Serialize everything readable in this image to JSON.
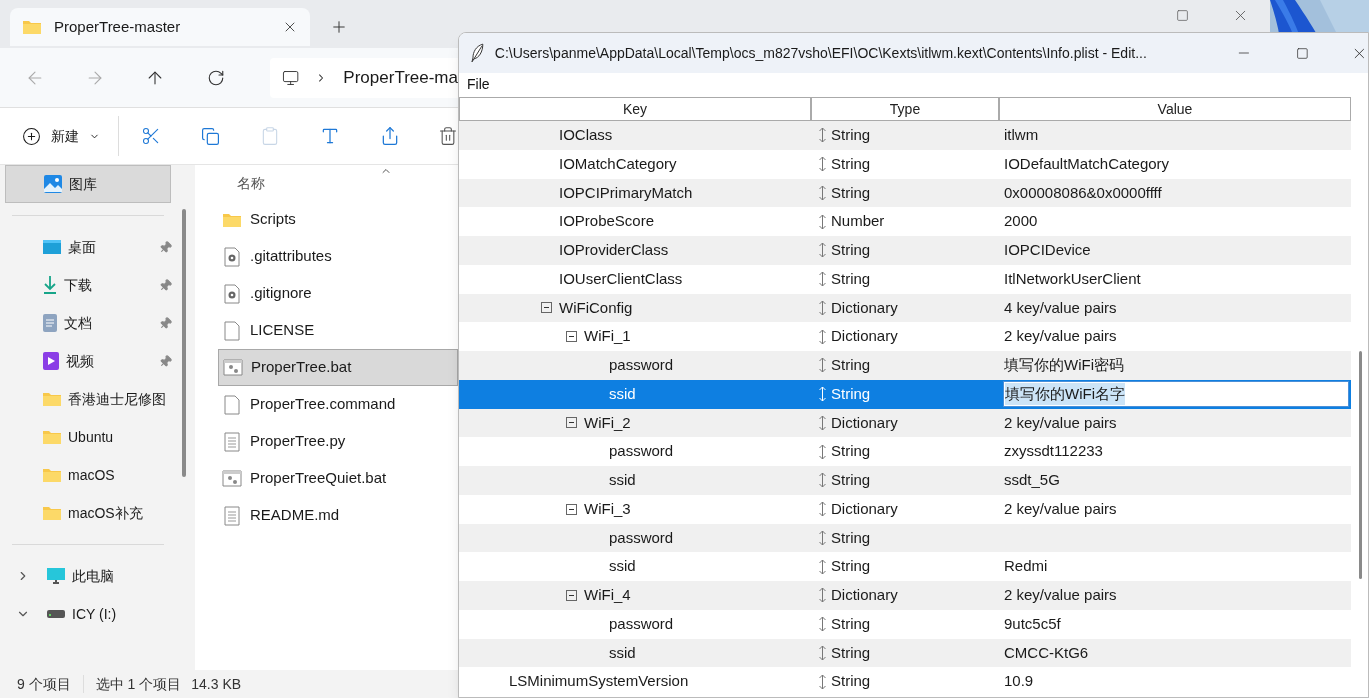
{
  "explorer": {
    "tab": {
      "title": "ProperTree-master"
    },
    "address": {
      "path": "ProperTree-ma"
    },
    "toolbar": {
      "new_label": "新建"
    },
    "sidebar": {
      "sections": [
        {
          "items": [
            {
              "label": "图库",
              "kind": "gallery",
              "selected": true
            }
          ]
        },
        {
          "items": [
            {
              "label": "桌面",
              "kind": "desktop",
              "pinned": true,
              "selected": false
            },
            {
              "label": "下载",
              "kind": "download",
              "pinned": true,
              "selected": false
            },
            {
              "label": "文档",
              "kind": "document",
              "pinned": true,
              "selected": false
            },
            {
              "label": "视频",
              "kind": "video",
              "pinned": true,
              "selected": false
            },
            {
              "label": "香港迪士尼修图",
              "kind": "folder",
              "pinned": false,
              "selected": false
            },
            {
              "label": "Ubuntu",
              "kind": "folder",
              "pinned": false,
              "selected": false
            },
            {
              "label": "macOS",
              "kind": "folder",
              "pinned": false,
              "selected": false
            },
            {
              "label": "macOS补充",
              "kind": "folder",
              "pinned": false,
              "selected": false
            }
          ]
        },
        {
          "items": [
            {
              "label": "此电脑",
              "kind": "computer",
              "expanded": false,
              "selected": false
            },
            {
              "label": "ICY (I:)",
              "kind": "drive",
              "expanded": true,
              "selected": false
            }
          ]
        }
      ]
    },
    "files": {
      "column": "名称",
      "rows": [
        {
          "name": "Scripts",
          "kind": "folder",
          "selected": false
        },
        {
          "name": ".gitattributes",
          "kind": "config",
          "selected": false
        },
        {
          "name": ".gitignore",
          "kind": "config",
          "selected": false
        },
        {
          "name": "LICENSE",
          "kind": "blank",
          "selected": false
        },
        {
          "name": "ProperTree.bat",
          "kind": "batch",
          "selected": true
        },
        {
          "name": "ProperTree.command",
          "kind": "blank",
          "selected": false
        },
        {
          "name": "ProperTree.py",
          "kind": "text",
          "selected": false
        },
        {
          "name": "ProperTreeQuiet.bat",
          "kind": "batch",
          "selected": false
        },
        {
          "name": "README.md",
          "kind": "text",
          "selected": false
        }
      ]
    },
    "status_bar": {
      "count": "9 个项目",
      "selection": "选中 1 个项目",
      "size": "14.3 KB"
    }
  },
  "editor": {
    "window": {
      "title": "C:\\Users\\panme\\AppData\\Local\\Temp\\ocs_m827vsho\\EFI\\OC\\Kexts\\itlwm.kext\\Contents\\Info.plist - Edit..."
    },
    "menu": [
      "File"
    ],
    "columns": [
      "Key",
      "Type",
      "Value"
    ],
    "rows": [
      {
        "key": "IOClass",
        "type": "String",
        "value": "itlwm",
        "selected": false
      },
      {
        "key": "IOMatchCategory",
        "type": "String",
        "value": "IODefaultMatchCategory",
        "selected": false
      },
      {
        "key": "IOPCIPrimaryMatch",
        "type": "String",
        "value": "0x00008086&0x0000ffff",
        "selected": false
      },
      {
        "key": "IOProbeScore",
        "type": "Number",
        "value": "2000",
        "selected": false
      },
      {
        "key": "IOProviderClass",
        "type": "String",
        "value": "IOPCIDevice",
        "selected": false
      },
      {
        "key": "IOUserClientClass",
        "type": "String",
        "value": "ItlNetworkUserClient",
        "selected": false
      },
      {
        "key": "WiFiConfig",
        "type": "Dictionary",
        "value": "4 key/value pairs",
        "selected": false,
        "expanded": true,
        "children": [
          {
            "key": "WiFi_1",
            "type": "Dictionary",
            "value": "2 key/value pairs",
            "selected": false,
            "expanded": true,
            "children": [
              {
                "key": "password",
                "type": "String",
                "value": "填写你的WiFi密码",
                "selected": false
              },
              {
                "key": "ssid",
                "type": "String",
                "value": "填写你的WiFi名字",
                "selected": true
              }
            ]
          },
          {
            "key": "WiFi_2",
            "type": "Dictionary",
            "value": "2 key/value pairs",
            "selected": false,
            "expanded": true,
            "children": [
              {
                "key": "password",
                "type": "String",
                "value": "zxyssdt112233",
                "selected": false
              },
              {
                "key": "ssid",
                "type": "String",
                "value": "ssdt_5G",
                "selected": false
              }
            ]
          },
          {
            "key": "WiFi_3",
            "type": "Dictionary",
            "value": "2 key/value pairs",
            "selected": false,
            "expanded": true,
            "children": [
              {
                "key": "password",
                "type": "String",
                "selected": false
              },
              {
                "key": "ssid",
                "type": "String",
                "value": "Redmi",
                "selected": false
              }
            ]
          },
          {
            "key": "WiFi_4",
            "type": "Dictionary",
            "value": "2 key/value pairs",
            "selected": false,
            "expanded": true,
            "children": [
              {
                "key": "password",
                "type": "String",
                "value": "9utc5c5f",
                "selected": false
              },
              {
                "key": "ssid",
                "type": "String",
                "value": "CMCC-KtG6",
                "selected": false
              }
            ]
          }
        ]
      }
    ],
    "tail_rows": [
      {
        "key": "LSMinimumSystemVersion",
        "type": "String",
        "value": "10.9",
        "selected": false
      }
    ]
  }
}
